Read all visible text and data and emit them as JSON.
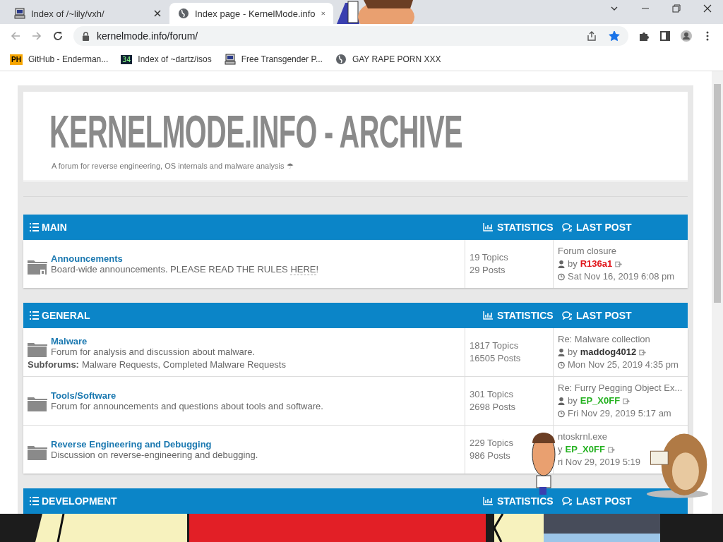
{
  "browser": {
    "tabs": [
      {
        "title": "Index of /~lily/vxh/",
        "selected": false
      },
      {
        "title": "Index page - KernelMode.info",
        "selected": true
      }
    ],
    "address": "kernelmode.info/forum/",
    "bookmark_star_on": true,
    "bookmarks": [
      {
        "title": "GitHub - Enderman...",
        "icon_text": "PH"
      },
      {
        "title": "Index of ~dartz/isos",
        "icon_text": "34"
      },
      {
        "title": "Free Transgender P..."
      },
      {
        "title": "GAY RAPE PORN XXX"
      }
    ]
  },
  "site": {
    "title": "KERNELMODE.INFO - ARCHIVE",
    "tagline": "A forum for reverse engineering, OS internals and malware analysis ☂"
  },
  "sections": [
    {
      "name": "MAIN",
      "stats_heading": "STATISTICS",
      "last_heading": "LAST POST",
      "forums": [
        {
          "name": "Announcements",
          "description": "Board-wide announcements. PLEASE READ THE RULES",
          "link": "HERE",
          "after_link": "!",
          "locked": true,
          "topics": "19 Topics",
          "posts": "29 Posts",
          "last": {
            "title": "Forum closure",
            "by": "by",
            "author": "R136a1",
            "color": "#e0161b",
            "date": "Sat Nov 16, 2019 6:08 pm",
            "user_icon": true,
            "clock_icon": true
          }
        }
      ]
    },
    {
      "name": "GENERAL",
      "stats_heading": "STATISTICS",
      "last_heading": "LAST POST",
      "forums": [
        {
          "name": "Malware",
          "description": "Forum for analysis and discussion about malware.",
          "locked": false,
          "subforums_label": "Subforums:",
          "subforums": "Malware Requests, Completed Malware Requests",
          "topics": "1817 Topics",
          "posts": "16505 Posts",
          "last": {
            "title": "Re: Malware collection",
            "by": "by",
            "author": "maddog4012",
            "color": "#333333",
            "date": "Mon Nov 25, 2019 4:35 pm",
            "user_icon": true,
            "clock_icon": true
          }
        },
        {
          "name": "Tools/Software",
          "description": "Forum for announcements and questions about tools and software.",
          "locked": false,
          "topics": "301 Topics",
          "posts": "2698 Posts",
          "last": {
            "title": "Re: Furry Pegging Object Ex...",
            "by": "by",
            "author": "EP_X0FF",
            "color": "#23b11f",
            "date": "Fri Nov 29, 2019 5:17 am",
            "user_icon": true,
            "clock_icon": true
          }
        },
        {
          "name": "Reverse Engineering and Debugging",
          "description": "Discussion on reverse-engineering and debugging.",
          "locked": false,
          "topics": "229 Topics",
          "posts": "986 Posts",
          "last": {
            "title": "ntoskrnl.exe",
            "by": "y",
            "author": "EP_X0FF",
            "color": "#23b11f",
            "date": "ri Nov 29, 2019 5:19",
            "user_icon": false,
            "clock_icon": false
          }
        }
      ]
    },
    {
      "name": "DEVELOPMENT",
      "stats_heading": "STATISTICS",
      "last_heading": "LAST POST"
    }
  ]
}
